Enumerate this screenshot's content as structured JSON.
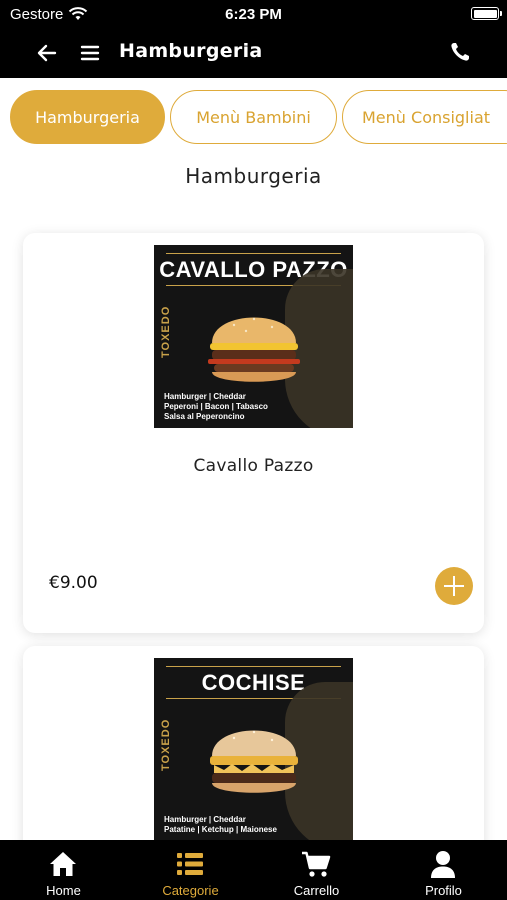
{
  "status_bar": {
    "carrier": "Gestore",
    "time": "6:23 PM"
  },
  "app_bar": {
    "title": "Hamburgeria"
  },
  "tabs": [
    {
      "label": "Hamburgeria",
      "active": true
    },
    {
      "label": "Menù Bambini",
      "active": false
    },
    {
      "label": "Menù Consigliat",
      "active": false
    }
  ],
  "section_title": "Hamburgeria",
  "products": [
    {
      "name": "Cavallo Pazzo",
      "price": "€9.00",
      "image": {
        "title": "CAVALLO PAZZO",
        "brand": "TOXEDO",
        "ingredients": [
          "Hamburger | Cheddar",
          "Peperoni | Bacon | Tabasco",
          "Salsa al Peperoncino"
        ]
      }
    },
    {
      "name": "Cochise",
      "image": {
        "title": "COCHISE",
        "brand": "TOXEDO",
        "ingredients": [
          "Hamburger | Cheddar",
          "Patatine | Ketchup | Maionese"
        ]
      }
    }
  ],
  "bottom_nav": [
    {
      "label": "Home",
      "icon": "home-icon",
      "active": false
    },
    {
      "label": "Categorie",
      "icon": "list-icon",
      "active": true
    },
    {
      "label": "Carrello",
      "icon": "cart-icon",
      "active": false
    },
    {
      "label": "Profilo",
      "icon": "user-icon",
      "active": false
    }
  ],
  "colors": {
    "accent": "#dfab3b",
    "bar": "#000000"
  }
}
